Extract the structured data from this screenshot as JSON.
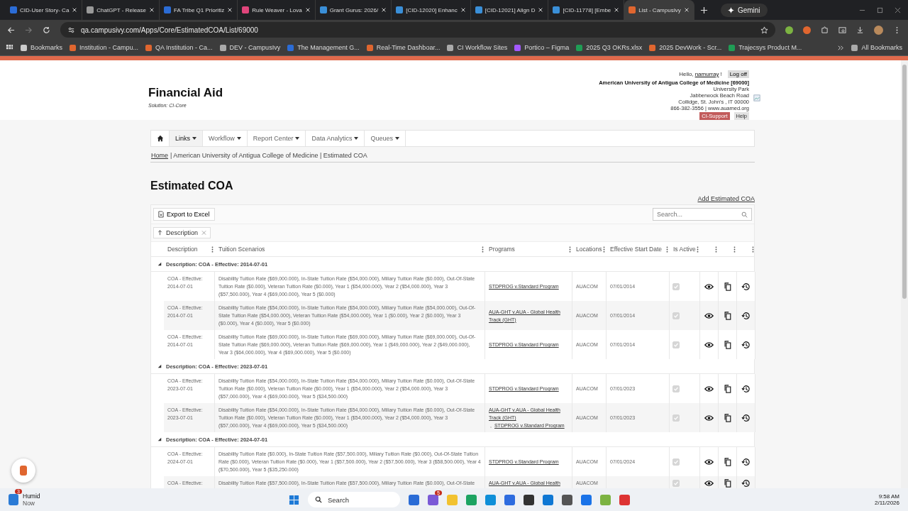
{
  "browser": {
    "tabs": [
      {
        "title": "CID-User Story- Ca",
        "selected": false
      },
      {
        "title": "ChatGPT - Release",
        "selected": false
      },
      {
        "title": "FA Tribe Q1 Prioritiz",
        "selected": false
      },
      {
        "title": "Rule Weaver - Lova",
        "selected": false
      },
      {
        "title": "Grant Gurus: 2026/",
        "selected": false
      },
      {
        "title": "[CID-12020] Enhanc",
        "selected": false
      },
      {
        "title": "[CID-12021] Align D",
        "selected": false
      },
      {
        "title": "[CID-11778] [Embe",
        "selected": false
      },
      {
        "title": "List - CampusIvy",
        "selected": true
      }
    ],
    "gemini": "Gemini",
    "url": "qa.campusivy.com/Apps/Core/EstimatedCOA/List/69000",
    "bookmarks": [
      "Bookmarks",
      "Institution - Campu...",
      "QA Institution - Ca...",
      "DEV - CampusIvy",
      "The Management G...",
      "Real-Time Dashboar...",
      "CI Workflow Sites",
      "Portico – Figma",
      "2025 Q3 OKRs.xlsx",
      "2025 DevWork - Scr...",
      "Trajecsys Product M..."
    ],
    "all_bookmarks": "All Bookmarks"
  },
  "header": {
    "title": "Financial Aid",
    "solution": "Solution: CI-Core",
    "greeting": "Hello,",
    "username": "namurray",
    "greeting_end": "!",
    "logoff": "Log off",
    "org": "American University of Antigua College of Medicine [69000]",
    "address": [
      "University Park",
      "Jabberwock Beach Road",
      "Collidge, St. John's , IT 00000",
      "866-382-3556 | www.auamed.org"
    ],
    "support": "CI-Support",
    "help": "Help"
  },
  "nav": [
    {
      "label": "Links",
      "selected": true
    },
    {
      "label": "Workflow",
      "selected": false
    },
    {
      "label": "Report Center",
      "selected": false
    },
    {
      "label": "Data Analytics",
      "selected": false
    },
    {
      "label": "Queues",
      "selected": false
    }
  ],
  "breadcrumb": {
    "home": "Home",
    "trail": "| American University of Antigua College of Medicine | Estimated COA"
  },
  "page_title": "Estimated COA",
  "add_link": "Add Estimated COA",
  "export": "Export to Excel",
  "search": {
    "placeholder": "Search..."
  },
  "group_chip": "Description",
  "program_separator": ",",
  "columns": [
    "Description",
    "Tuition Scenarios",
    "Programs",
    "Locations",
    "Effective Start Date",
    "Is Active"
  ],
  "groups": [
    {
      "label": "Description: COA - Effective: 2014-07-01",
      "expanded": true,
      "rows": [
        {
          "description": "COA - Effective: 2014-07-01",
          "scenarios": "Disability Tuition Rate ($69,000.000), In-State Tuition Rate ($54,000.000), Miliary Tuition Rate ($0.000), Out-Of-State Tuition Rate ($0.000), Veteran Tuition Rate ($0.000), Year 1 ($54,000.000), Year 2 ($54,000.000), Year 3 ($57,500.000), Year 4 ($69,000.000), Year 5 ($0.000)",
          "programs": [
            "STDPROG v.Standard Program"
          ],
          "location": "AUACOM",
          "start_date": "07/01/2014",
          "active": true
        },
        {
          "description": "COA - Effective: 2014-07-01",
          "scenarios": "Disability Tuition Rate ($54,000.000), In-State Tuition Rate ($54,000.000), Miliary Tuition Rate ($54,000.000), Out-Of-State Tuition Rate ($54,000.000), Veteran Tuition Rate ($54,000.000), Year 1 ($0.000), Year 2 ($0.000), Year 3 ($0.000), Year 4 ($0.000), Year 5 ($0.000)",
          "programs": [
            "AUA-GHT v.AUA - Global Health Track (GHT)"
          ],
          "location": "AUACOM",
          "start_date": "07/01/2014",
          "active": true
        },
        {
          "description": "COA - Effective: 2014-07-01",
          "scenarios": "Disability Tuition Rate ($69,000.000), In-State Tuition Rate ($69,000.000), Miliary Tuition Rate ($69,000.000), Out-Of-State Tuition Rate ($69,000.000), Veteran Tuition Rate ($69,000.000), Year 1 ($49,000.000), Year 2 ($49,000.000), Year 3 ($64,000.000), Year 4 ($69,000.000), Year 5 ($0.000)",
          "programs": [
            "STDPROG v.Standard Program"
          ],
          "location": "AUACOM",
          "start_date": "07/01/2014",
          "active": true
        }
      ]
    },
    {
      "label": "Description: COA - Effective: 2023-07-01",
      "expanded": true,
      "rows": [
        {
          "description": "COA - Effective: 2023-07-01",
          "scenarios": "Disability Tuition Rate ($54,000.000), In-State Tuition Rate ($54,000.000), Miliary Tuition Rate ($0.000), Out-Of-State Tuition Rate ($0.000), Veteran Tuition Rate ($0.000), Year 1 ($54,000.000), Year 2 ($54,000.000), Year 3 ($57,000.000), Year 4 ($69,000.000), Year 5 ($34,500.000)",
          "programs": [
            "STDPROG v.Standard Program"
          ],
          "location": "AUACOM",
          "start_date": "07/01/2023",
          "active": true
        },
        {
          "description": "COA - Effective: 2023-07-01",
          "scenarios": "Disability Tuition Rate ($54,000.000), In-State Tuition Rate ($54,000.000), Miliary Tuition Rate ($0.000), Out-Of-State Tuition Rate ($0.000), Veteran Tuition Rate ($0.000), Year 1 ($54,000.000), Year 2 ($54,000.000), Year 3 ($57,000.000), Year 4 ($69,000.000), Year 5 ($34,500.000)",
          "programs": [
            "AUA-GHT v.AUA - Global Health Track (GHT)",
            "STDPROG v.Standard Program"
          ],
          "location": "AUACOM",
          "start_date": "07/01/2023",
          "active": true
        }
      ]
    },
    {
      "label": "Description: COA - Effective: 2024-07-01",
      "expanded": true,
      "rows": [
        {
          "description": "COA - Effective: 2024-07-01",
          "scenarios": "Disability Tuition Rate ($0.000), In-State Tuition Rate ($57,500.000), Miliary Tuition Rate ($0.000), Out-Of-State Tuition Rate ($0.000), Veteran Tuition Rate ($0.000), Year 1 ($57,500.000), Year 2 ($57,500.000), Year 3 ($58,500.000), Year 4 ($70,500.000), Year 5 ($35,250.000)",
          "programs": [
            "STDPROG v.Standard Program"
          ],
          "location": "AUACOM",
          "start_date": "07/01/2024",
          "active": true
        },
        {
          "description": "COA - Effective:",
          "scenarios": "Disability Tuition Rate ($57,500.000), In-State Tuition Rate ($57,500.000), Miliary Tuition Rate ($0.000), Out-Of-State",
          "programs": [
            "AUA-GHT v.AUA - Global Health"
          ],
          "location": "AUACOM",
          "start_date": "",
          "active": true
        }
      ]
    }
  ],
  "taskbar": {
    "weather": "Humid",
    "weather_time": "Now",
    "weather_badge": "3",
    "search": "Search",
    "teams_badge": "5",
    "time": "9:58 AM",
    "date": "2/11/2026"
  }
}
